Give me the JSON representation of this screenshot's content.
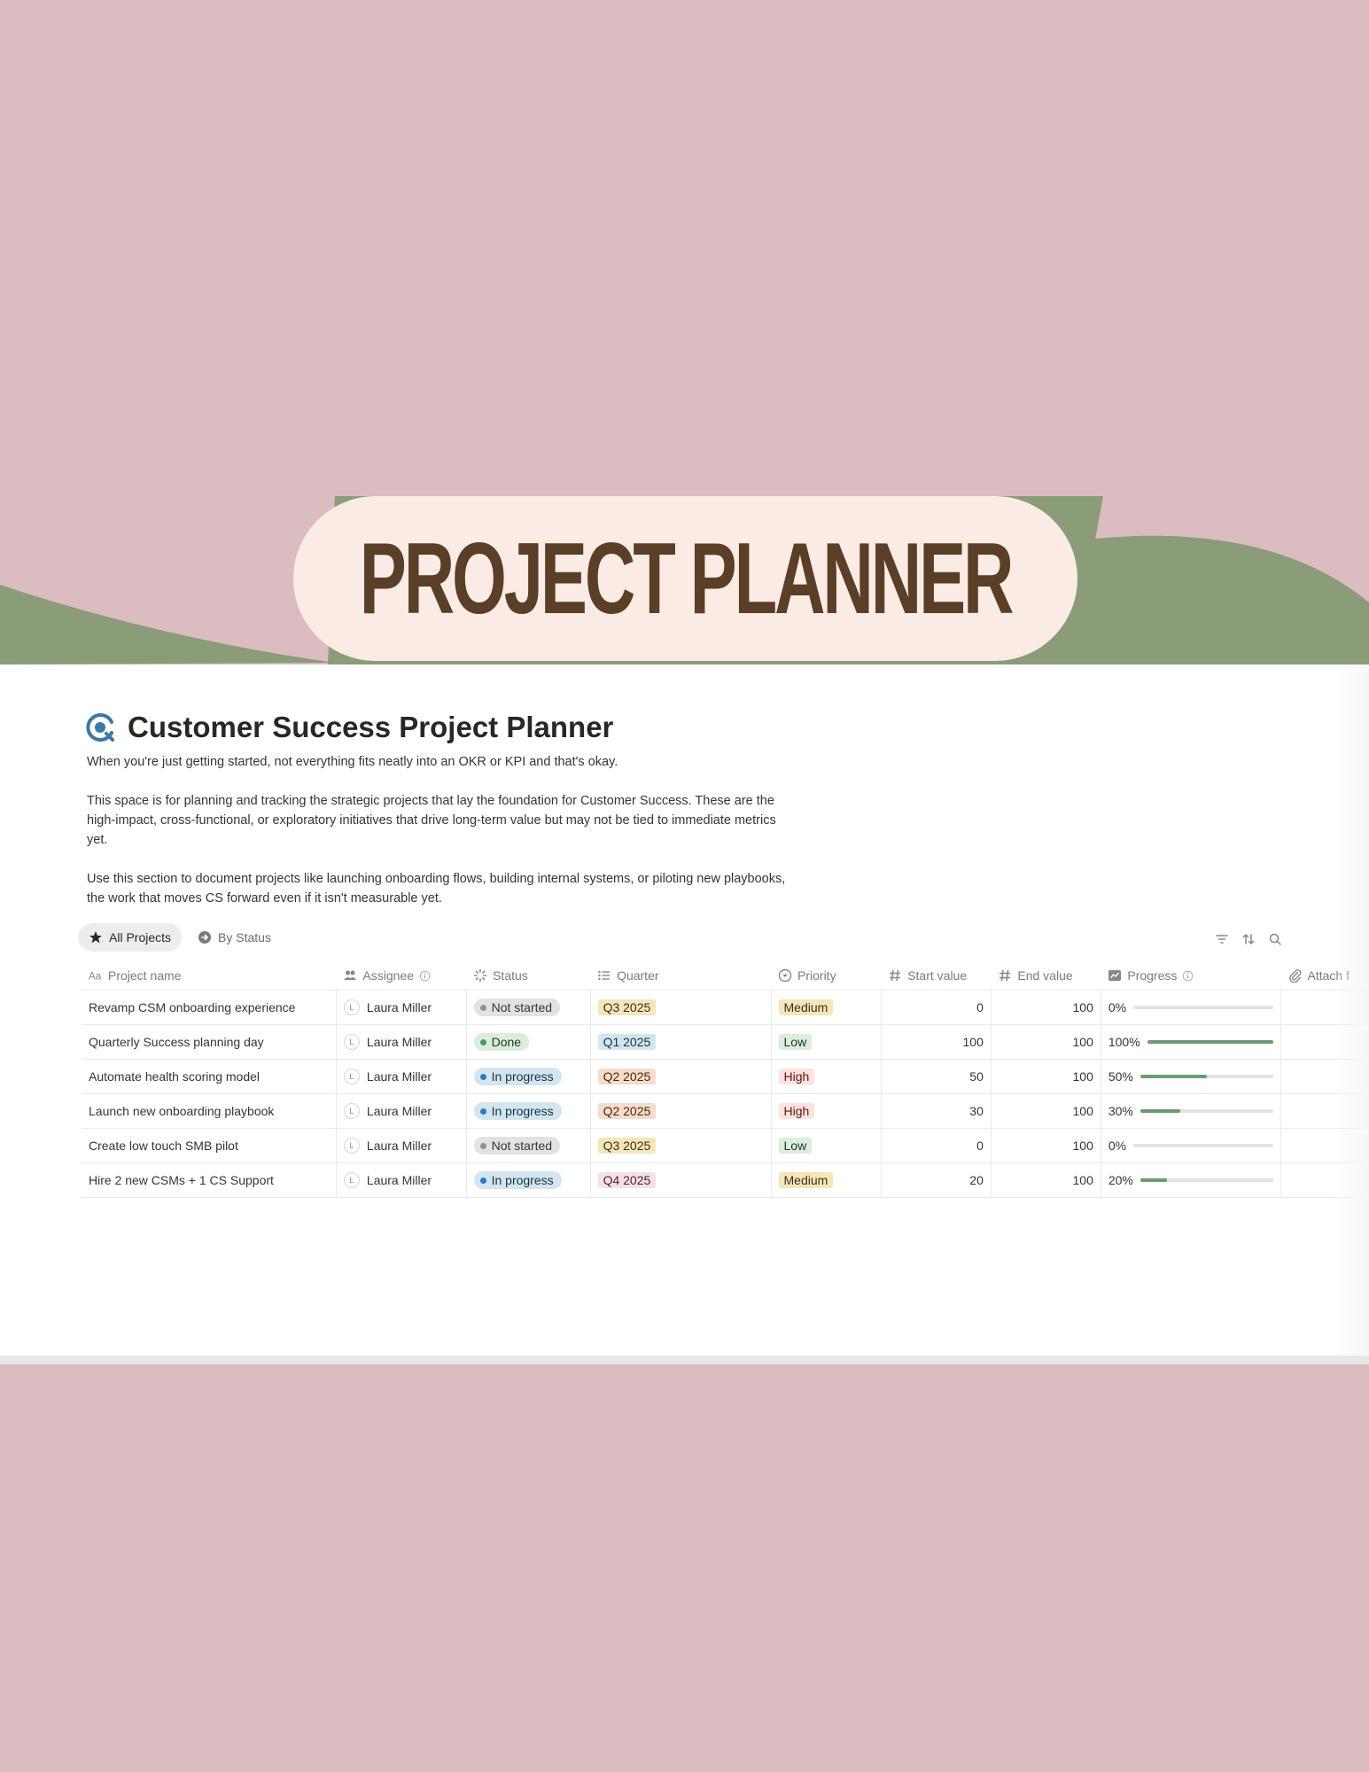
{
  "banner": {
    "title": "PROJECT PLANNER"
  },
  "colors": {
    "background": "#dbbcc0",
    "banner_green": "#8b9c78",
    "pill": "#faebe5",
    "title_brown": "#5a3e25",
    "progress_fill": "#6a9a73"
  },
  "page": {
    "title": "Customer Success Project Planner",
    "title_icon": "target-refresh-icon",
    "description": [
      "When you're just getting started, not everything fits neatly into an OKR or KPI and that's okay.",
      "This space is for planning and tracking the strategic projects that lay the foundation for Customer Success. These are the high-impact, cross-functional, or exploratory initiatives that drive long-term value but may not be tied to immediate metrics yet.",
      "Use this section to document projects like launching onboarding flows, building internal systems, or piloting new playbooks, the work that moves CS forward even if it isn't measurable yet."
    ]
  },
  "views": {
    "tab1": "All Projects",
    "tab2": "By Status"
  },
  "toolbar": {
    "icons": [
      "filter-icon",
      "sort-icon",
      "search-icon"
    ]
  },
  "table": {
    "columns": {
      "name": "Project name",
      "assignee": "Assignee",
      "status": "Status",
      "quarter": "Quarter",
      "priority": "Priority",
      "start": "Start value",
      "end": "End value",
      "progress": "Progress",
      "attach": "Attach f"
    },
    "rows": [
      {
        "name": "Revamp CSM onboarding experience",
        "avatar": "L",
        "assignee": "Laura Miller",
        "status": "Not started",
        "quarter": "Q3 2025",
        "priority": "Medium",
        "start": "0",
        "end": "100",
        "progress": "0%",
        "progress_value": 0
      },
      {
        "name": "Quarterly Success planning day",
        "avatar": "L",
        "assignee": "Laura Miller",
        "status": "Done",
        "quarter": "Q1 2025",
        "priority": "Low",
        "start": "100",
        "end": "100",
        "progress": "100%",
        "progress_value": 100
      },
      {
        "name": "Automate health scoring model",
        "avatar": "L",
        "assignee": "Laura Miller",
        "status": "In progress",
        "quarter": "Q2 2025",
        "priority": "High",
        "start": "50",
        "end": "100",
        "progress": "50%",
        "progress_value": 50
      },
      {
        "name": "Launch new onboarding playbook",
        "avatar": "L",
        "assignee": "Laura Miller",
        "status": "In progress",
        "quarter": "Q2 2025",
        "priority": "High",
        "start": "30",
        "end": "100",
        "progress": "30%",
        "progress_value": 30
      },
      {
        "name": "Create low touch SMB pilot",
        "avatar": "L",
        "assignee": "Laura Miller",
        "status": "Not started",
        "quarter": "Q3 2025",
        "priority": "Low",
        "start": "0",
        "end": "100",
        "progress": "0%",
        "progress_value": 0
      },
      {
        "name": "Hire 2 new CSMs + 1 CS Support",
        "avatar": "L",
        "assignee": "Laura Miller",
        "status": "In progress",
        "quarter": "Q4 2025",
        "priority": "Medium",
        "start": "20",
        "end": "100",
        "progress": "20%",
        "progress_value": 20
      }
    ]
  }
}
